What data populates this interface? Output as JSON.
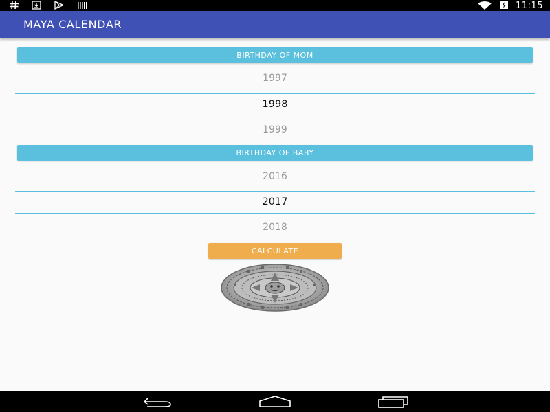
{
  "status_bar": {
    "time": "11:15",
    "icons": [
      "hash-icon",
      "download-icon",
      "play-store-icon",
      "barcode-icon",
      "wifi-icon",
      "battery-icon"
    ]
  },
  "app_bar": {
    "title": "MAYA CALENDAR",
    "color": "#3f51b5"
  },
  "mom_section": {
    "button_label": "BIRTHDAY OF MOM",
    "years": [
      {
        "label": "1997",
        "selected": false
      },
      {
        "label": "1998",
        "selected": true
      },
      {
        "label": "1999",
        "selected": false
      }
    ]
  },
  "baby_section": {
    "button_label": "BIRTHDAY OF BABY",
    "years": [
      {
        "label": "2016",
        "selected": false
      },
      {
        "label": "2017",
        "selected": true
      },
      {
        "label": "2018",
        "selected": false
      }
    ]
  },
  "calculate_button": {
    "label": "CALCULATE",
    "color": "#f0ad4e"
  },
  "image": {
    "icon": "maya-calendar-stone-image"
  },
  "nav_bar": {
    "icons": [
      "back-icon",
      "home-icon",
      "recents-icon"
    ]
  },
  "colors": {
    "section_button": "#5bc0de",
    "divider": "#5bc0de"
  }
}
